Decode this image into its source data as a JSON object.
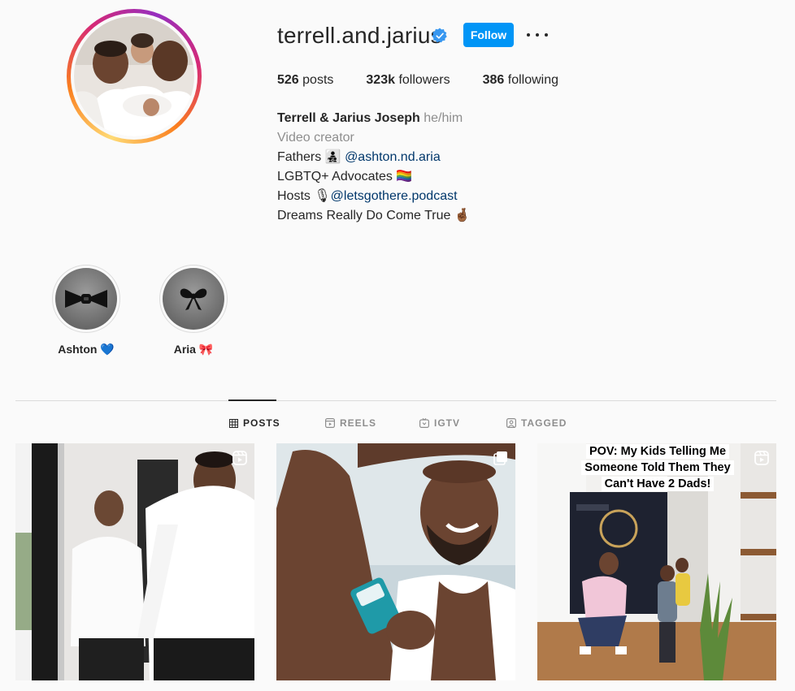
{
  "profile": {
    "username": "terrell.and.jarius",
    "verified": true,
    "follow_label": "Follow",
    "stats": {
      "posts_count": "526",
      "posts_label": "posts",
      "followers_count": "323k",
      "followers_label": "followers",
      "following_count": "386",
      "following_label": "following"
    },
    "bio": {
      "name": "Terrell & Jarius Joseph",
      "pronouns": "he/him",
      "category": "Video creator",
      "line1_text": "Fathers 👨‍👧‍👦",
      "line1_link": "@ashton.nd.aria",
      "line2_text": "LGBTQ+ Advocates 🏳️‍🌈",
      "line3_text": "Hosts 🎙",
      "line3_link": "@letsgothere.podcast",
      "line4_text": "Dreams Really Do Come True 🤞🏾"
    }
  },
  "highlights": [
    {
      "label": "Ashton 💙",
      "icon": "bow-tie-icon"
    },
    {
      "label": "Aria 🎀",
      "icon": "hair-bow-icon"
    }
  ],
  "tabs": [
    {
      "label": "POSTS",
      "icon": "grid-icon",
      "active": true
    },
    {
      "label": "REELS",
      "icon": "reels-icon",
      "active": false
    },
    {
      "label": "IGTV",
      "icon": "igtv-icon",
      "active": false
    },
    {
      "label": "TAGGED",
      "icon": "tagged-icon",
      "active": false
    }
  ],
  "posts": [
    {
      "badge": "reel-icon"
    },
    {
      "badge": "multiple-icon"
    },
    {
      "badge": "reel-icon",
      "caption": "POV: My Kids Telling Me Someone Told Them They Can't Have 2 Dads!"
    }
  ],
  "colors": {
    "follow_button": "#0095f6",
    "link": "#00376b",
    "secondary_text": "#8e8e8e",
    "background": "#fafafa"
  }
}
